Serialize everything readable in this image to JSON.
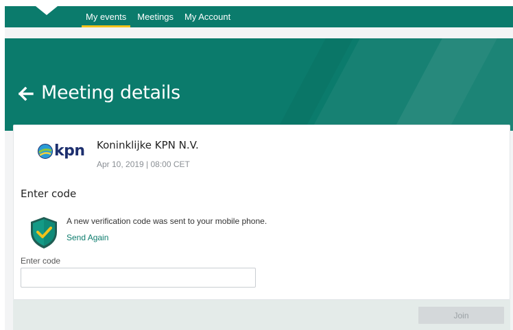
{
  "nav": {
    "items": [
      {
        "label": "My events",
        "active": true
      },
      {
        "label": "Meetings",
        "active": false
      },
      {
        "label": "My Account",
        "active": false
      }
    ]
  },
  "header": {
    "back_icon": "arrow-left-icon",
    "title": "Meeting details"
  },
  "meeting": {
    "logo_text": "kpn",
    "company": "Koninklijke KPN N.V.",
    "datetime": "Apr 10, 2019 | 08:00 CET"
  },
  "verification": {
    "section_title": "Enter code",
    "icon": "shield-check-icon",
    "message": "A new verification code was sent to your mobile phone.",
    "resend_label": "Send Again",
    "field_label": "Enter code",
    "code_value": "",
    "placeholder": ""
  },
  "footer": {
    "join_label": "Join",
    "join_disabled": true
  },
  "colors": {
    "brand": "#0b7b6c",
    "nav_active_underline": "#f2c21b",
    "link": "#0b7b6c",
    "disabled_button": "#d4d8da"
  }
}
